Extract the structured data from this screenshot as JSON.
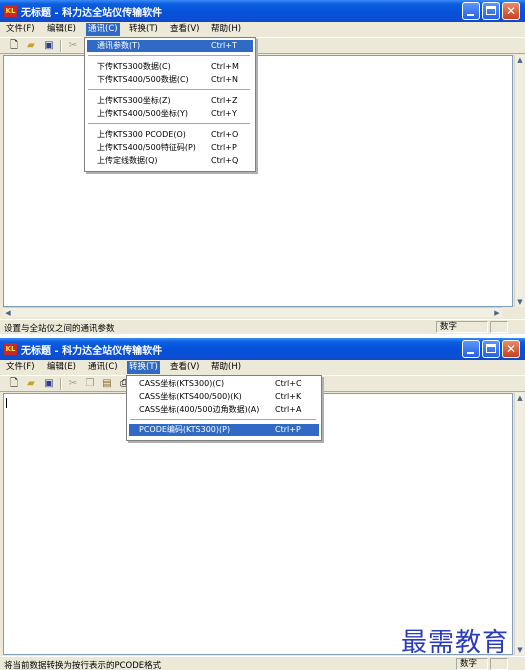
{
  "app": {
    "title": "无标题 - 科力达全站仪传输软件"
  },
  "menubar": [
    "文件(F)",
    "编辑(E)",
    "通讯(C)",
    "转换(T)",
    "查看(V)",
    "帮助(H)"
  ],
  "window1": {
    "active_menu": "通讯(C)",
    "dropdown": [
      {
        "label": "通讯参数(T)",
        "shortcut": "Ctrl+T"
      },
      {
        "label": "下传KTS300数据(C)",
        "shortcut": "Ctrl+M"
      },
      {
        "label": "下传KTS400/500数据(C)",
        "shortcut": "Ctrl+N"
      },
      {
        "label": "上传KTS300坐标(Z)",
        "shortcut": "Ctrl+Z"
      },
      {
        "label": "上传KTS400/500坐标(Y)",
        "shortcut": "Ctrl+Y"
      },
      {
        "label": "上传KTS300 PCODE(O)",
        "shortcut": "Ctrl+O"
      },
      {
        "label": "上传KTS400/500特征码(P)",
        "shortcut": "Ctrl+P"
      },
      {
        "label": "上传定线数据(Q)",
        "shortcut": "Ctrl+Q"
      }
    ],
    "status_text": "设置与全站仪之间的通讯参数",
    "status_pane": "数字"
  },
  "window2": {
    "active_menu": "转换(T)",
    "dropdown": [
      {
        "label": "CASS坐标(KTS300)(C)",
        "shortcut": "Ctrl+C"
      },
      {
        "label": "CASS坐标(KTS400/500)(K)",
        "shortcut": "Ctrl+K"
      },
      {
        "label": "CASS坐标(400/500边角数据)(A)",
        "shortcut": "Ctrl+A"
      },
      {
        "label": "PCODE编码(KTS300)(P)",
        "shortcut": "Ctrl+P"
      }
    ],
    "status_text": "将当前数据转换为按行表示的PCODE格式",
    "status_pane": "数字"
  },
  "watermark": "最需教育",
  "icons": [
    "new-file-icon",
    "open-folder-icon",
    "save-icon",
    "cut-icon",
    "copy-icon",
    "paste-icon",
    "print-icon",
    "minimize-icon",
    "maximize-icon",
    "close-icon"
  ]
}
